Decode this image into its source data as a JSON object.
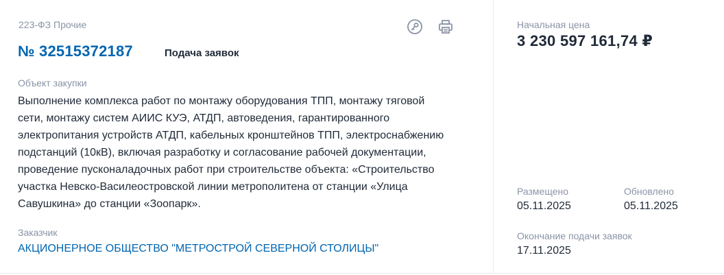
{
  "law_type": "223-ФЗ Прочие",
  "purchase_number": "№ 32515372187",
  "status": "Подача заявок",
  "icons": {
    "key": "key-icon",
    "print": "printer-icon"
  },
  "object": {
    "label": "Объект закупки",
    "lines": [
      "Выполнение комплекса работ по монтажу оборудования ТПП, монтажу тяговой",
      "сети, монтажу систем АИИС КУЭ, АТДП, автоведения, гарантированного",
      "электропитания устройств АТДП, кабельных кронштейнов ТПП, электроснабжению",
      "подстанций (10кВ), включая разработку и согласование рабочей документации,",
      "проведение пусконаладочных работ при строительстве объекта: «Строительство",
      "участка Невско-Василеостровской линии метрополитена от станции «Улица",
      "Савушкина» до станции «Зоопарк»."
    ]
  },
  "customer": {
    "label": "Заказчик",
    "name": "АКЦИОНЕРНОЕ ОБЩЕСТВО \"МЕТРОСТРОЙ СЕВЕРНОЙ СТОЛИЦЫ\""
  },
  "price": {
    "label": "Начальная цена",
    "value": "3 230 597 161,74 ₽"
  },
  "dates": {
    "placed_label": "Размещено",
    "placed_value": "05.11.2025",
    "updated_label": "Обновлено",
    "updated_value": "05.11.2025",
    "end_label": "Окончание подачи заявок",
    "end_value": "17.11.2025"
  },
  "colors": {
    "accent": "#0065b1",
    "muted": "#8a94a6",
    "text": "#1f2937",
    "border": "#e5e8ec"
  }
}
